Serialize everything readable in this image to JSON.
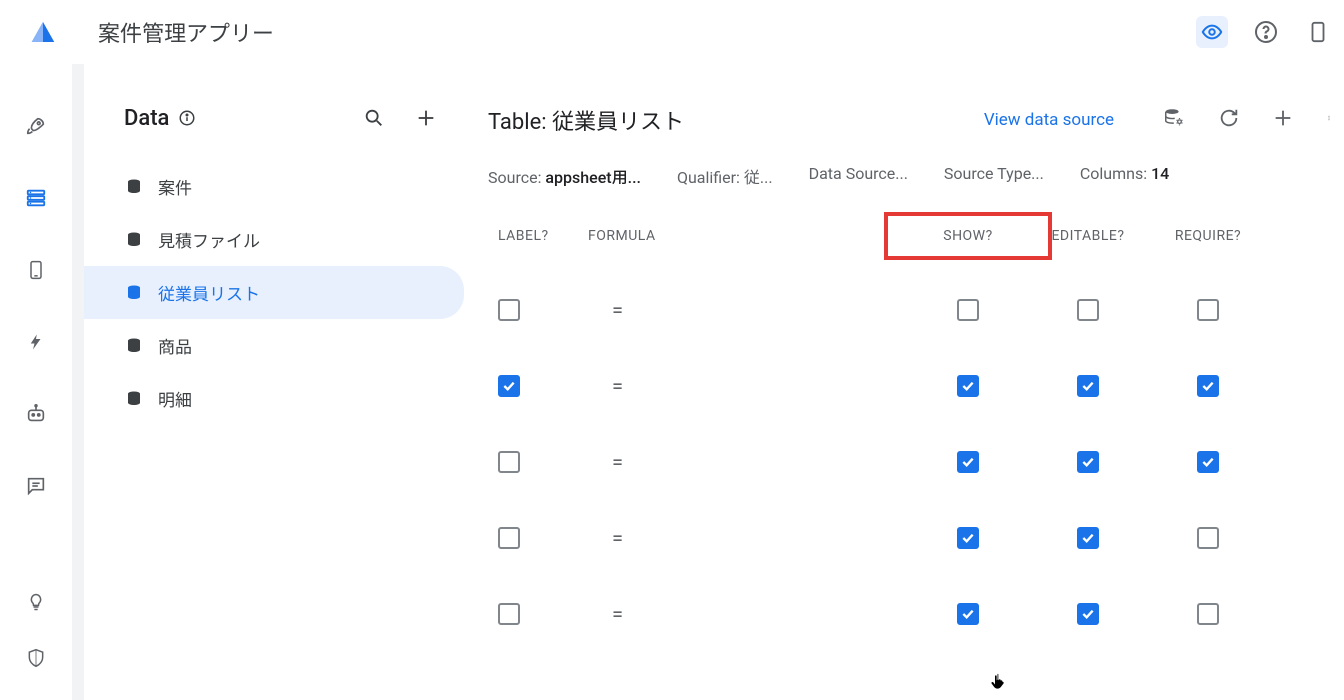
{
  "app_title": "案件管理アプリー",
  "data_section": {
    "title": "Data",
    "items": [
      {
        "label": "案件"
      },
      {
        "label": "見積ファイル"
      },
      {
        "label": "従業員リスト"
      },
      {
        "label": "商品"
      },
      {
        "label": "明細"
      }
    ],
    "selected_index": 2
  },
  "table": {
    "title_prefix": "Table:",
    "title_value": "従業員リスト",
    "view_data_source": "View data source",
    "meta": {
      "source_label": "Source:",
      "source_value": "appsheet用...",
      "qualifier_label": "Qualifier:",
      "qualifier_value": "従...",
      "datasource_label": "Data Source...",
      "sourcetype_label": "Source Type...",
      "columns_label": "Columns:",
      "columns_value": "14"
    },
    "headers": {
      "label": "LABEL?",
      "formula": "FORMULA",
      "show": "SHOW?",
      "editable": "EDITABLE?",
      "require": "REQUIRE?"
    },
    "rows": [
      {
        "label": false,
        "formula": "=",
        "show": false,
        "editable": false,
        "require": false
      },
      {
        "label": true,
        "formula": "=",
        "show": true,
        "editable": true,
        "require": true
      },
      {
        "label": false,
        "formula": "=",
        "show": true,
        "editable": true,
        "require": true
      },
      {
        "label": false,
        "formula": "=",
        "show": true,
        "editable": true,
        "require": false
      },
      {
        "label": false,
        "formula": "=",
        "show": true,
        "editable": true,
        "require": false
      }
    ]
  }
}
